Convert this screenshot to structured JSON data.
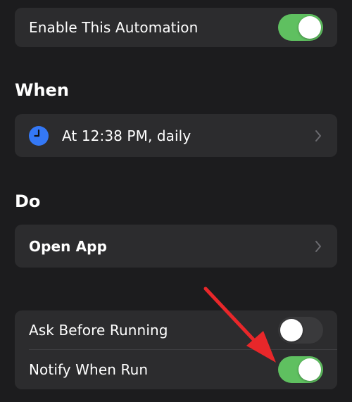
{
  "enable_card": {
    "label": "Enable This Automation",
    "toggle_on": true
  },
  "when": {
    "title": "When",
    "trigger": {
      "icon": "clock-icon",
      "label": "At 12:38 PM, daily"
    }
  },
  "do": {
    "title": "Do",
    "action": {
      "label": "Open App"
    }
  },
  "options": {
    "ask_before_running": {
      "label": "Ask Before Running",
      "toggle_on": false
    },
    "notify_when_run": {
      "label": "Notify When Run",
      "toggle_on": true
    }
  },
  "colors": {
    "background": "#1c1c1e",
    "card": "#2c2c2e",
    "toggle_on": "#5fc060",
    "toggle_off": "#3a3a3c",
    "clock_blue": "#3478f6",
    "annotation_arrow": "#e8272a"
  },
  "annotation": {
    "icon": "red-arrow-icon",
    "points_to": "notify-when-run-toggle"
  }
}
